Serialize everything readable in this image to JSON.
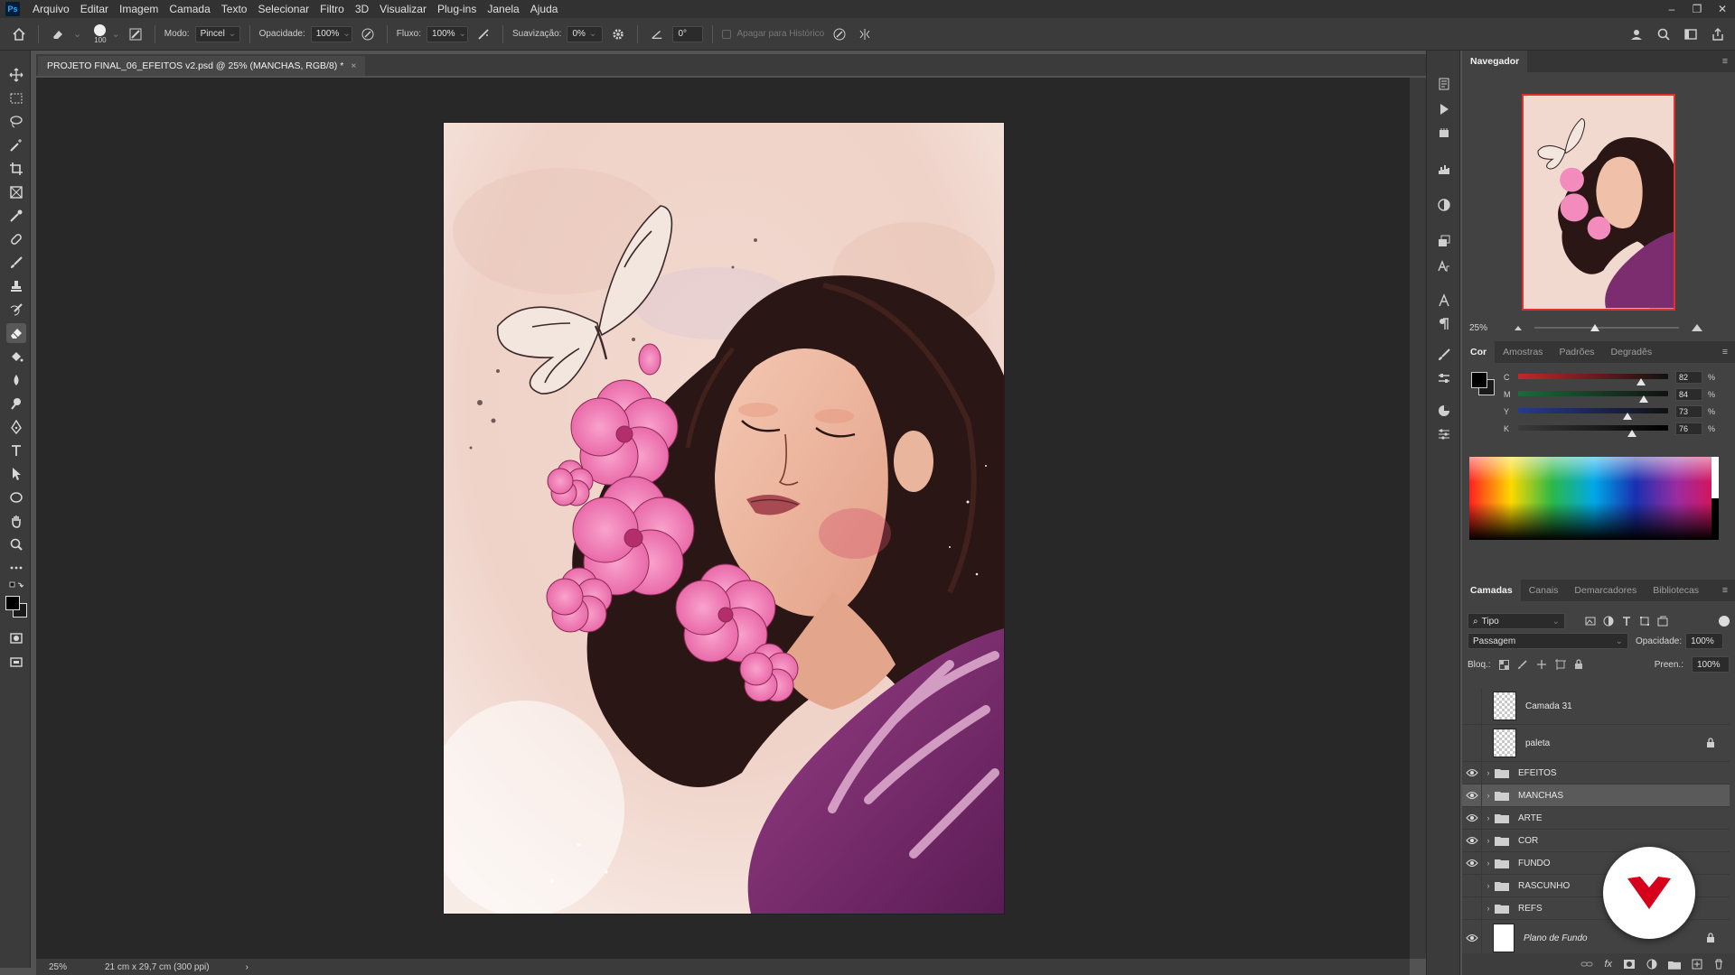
{
  "app": {
    "logo": "Ps"
  },
  "menu": [
    "Arquivo",
    "Editar",
    "Imagem",
    "Camada",
    "Texto",
    "Selecionar",
    "Filtro",
    "3D",
    "Visualizar",
    "Plug-ins",
    "Janela",
    "Ajuda"
  ],
  "options": {
    "brush_size": "100",
    "mode_label": "Modo:",
    "mode_value": "Pincel",
    "opacity_label": "Opacidade:",
    "opacity_value": "100%",
    "flow_label": "Fluxo:",
    "flow_value": "100%",
    "smoothing_label": "Suavização:",
    "smoothing_value": "0%",
    "angle_value": "0°",
    "erase_history_label": "Apagar para Histórico"
  },
  "document": {
    "tab_title": "PROJETO FINAL_06_EFEITOS v2.psd @ 25% (MANCHAS, RGB/8) *",
    "close": "×"
  },
  "status": {
    "zoom": "25%",
    "doc_size": "21 cm x 29,7 cm (300 ppi)",
    "arrow": "›"
  },
  "navigator": {
    "title": "Navegador",
    "zoom": "25%"
  },
  "color_panel": {
    "tabs": [
      "Cor",
      "Amostras",
      "Padrões",
      "Degradês"
    ],
    "channels": [
      {
        "label": "C",
        "value": "82",
        "unit": "%",
        "level": 0.82
      },
      {
        "label": "M",
        "value": "84",
        "unit": "%",
        "level": 0.84
      },
      {
        "label": "Y",
        "value": "73",
        "unit": "%",
        "level": 0.73
      },
      {
        "label": "K",
        "value": "76",
        "unit": "%",
        "level": 0.76
      }
    ]
  },
  "layers_panel": {
    "tabs": [
      "Camadas",
      "Canais",
      "Demarcadores",
      "Bibliotecas"
    ],
    "filter_value": "Tipo",
    "blend_mode": "Passagem",
    "opacity_label": "Opacidade:",
    "opacity_value": "100%",
    "lock_label": "Bloq.:",
    "fill_label": "Preen.:",
    "fill_value": "100%",
    "layers": [
      {
        "name": "Camada 31",
        "kind": "layer",
        "visible": false,
        "locked": false
      },
      {
        "name": "paleta",
        "kind": "layer",
        "visible": false,
        "locked": true
      },
      {
        "name": "EFEITOS",
        "kind": "group",
        "visible": true
      },
      {
        "name": "MANCHAS",
        "kind": "group",
        "visible": true,
        "selected": true
      },
      {
        "name": "ARTE",
        "kind": "group",
        "visible": true
      },
      {
        "name": "COR",
        "kind": "group",
        "visible": true
      },
      {
        "name": "FUNDO",
        "kind": "group",
        "visible": true
      },
      {
        "name": "RASCUNHO",
        "kind": "group",
        "visible": false
      },
      {
        "name": "REFS",
        "kind": "group",
        "visible": false
      },
      {
        "name": "Plano de Fundo",
        "kind": "background",
        "visible": true,
        "locked": true
      }
    ]
  },
  "colors": {
    "accent": "#31a8ff",
    "badge_red": "#d6001c"
  }
}
